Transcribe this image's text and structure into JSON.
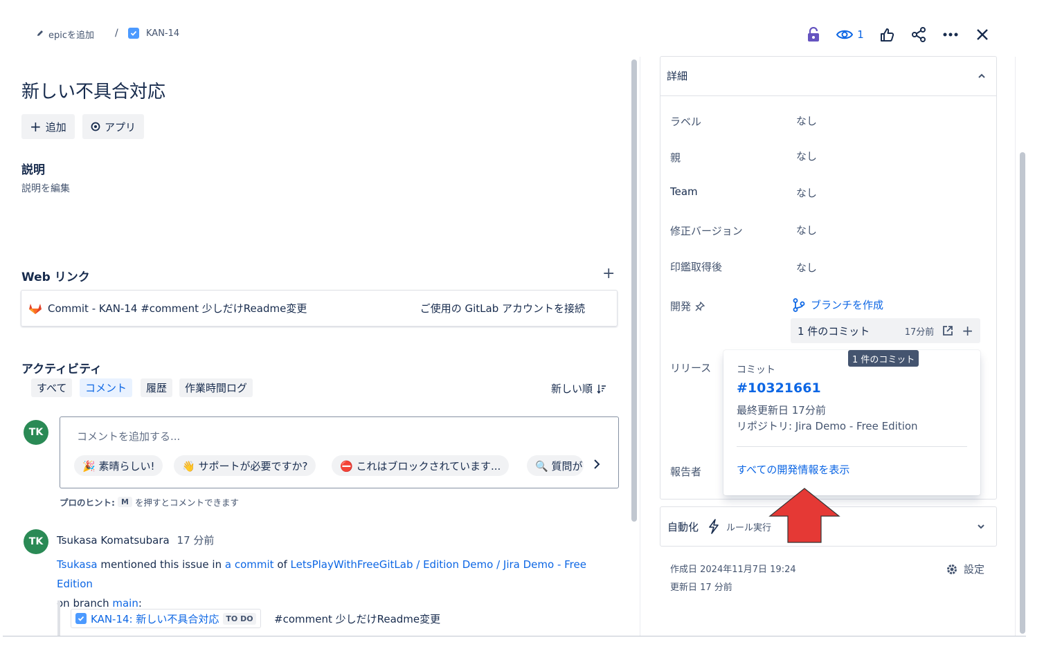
{
  "breadcrumb": {
    "epic_label": "epicを追加",
    "separator": "/",
    "issue_key": "KAN-14"
  },
  "top_actions": {
    "watch_count": "1"
  },
  "issue": {
    "title": "新しい不具合対応"
  },
  "toolbar": {
    "add_label": "追加",
    "apps_label": "アプリ"
  },
  "description": {
    "heading": "説明",
    "edit_label": "説明を編集"
  },
  "weblinks": {
    "heading": "Web リンク",
    "item_text": "Commit - KAN-14 #comment 少しだけReadme変更",
    "connect_label": "ご使用の GitLab アカウントを接続"
  },
  "activity": {
    "heading": "アクティビティ",
    "tabs": [
      "すべて",
      "コメント",
      "履歴",
      "作業時間ログ"
    ],
    "sort_label": "新しい順"
  },
  "comment_box": {
    "avatar_initials": "TK",
    "placeholder": "コメントを追加する...",
    "chips": [
      "🎉 素晴らしい!",
      "👋 サポートが必要ですか?",
      "⛔ これはブロックされています...",
      "🔍 質問が"
    ]
  },
  "hint": {
    "prefix": "プロのヒント:",
    "key": "M",
    "suffix": "を押すとコメントできます"
  },
  "comment": {
    "avatar_initials": "TK",
    "author": "Tsukasa Komatsubara",
    "time": "17 分前",
    "mention_user": "Tsukasa",
    "text_1": " mentioned this issue in ",
    "commit_link": "a commit",
    "text_2": " of ",
    "repo_link": "LetsPlayWithFreeGitLab / Edition Demo / Jira Demo - Free Edition",
    "text_3": "on branch ",
    "branch": "main",
    "text_4": ":",
    "issue_link": "KAN-14: 新しい不具合対応",
    "status": "TO DO",
    "message": "#comment 少しだけReadme変更"
  },
  "details": {
    "heading": "詳細",
    "fields": [
      {
        "label": "ラベル",
        "value": "なし"
      },
      {
        "label": "親",
        "value": "なし"
      },
      {
        "label": "Team",
        "value": "なし"
      },
      {
        "label": "修正バージョン",
        "value": "なし"
      },
      {
        "label": "印鑑取得後",
        "value": "なし"
      }
    ],
    "development_label": "開発",
    "create_branch": "ブランチを作成",
    "commits_label": "1 件のコミット",
    "commits_time": "17分前",
    "release_label": "リリース",
    "reporter_label": "報告者"
  },
  "tooltip": {
    "text": "1 件のコミット"
  },
  "popup": {
    "heading": "コミット",
    "commit_id": "#10321661",
    "updated": "最終更新日 17分前",
    "repository": "リポジトリ: Jira Demo - Free Edition",
    "view_all": "すべての開発情報を表示"
  },
  "automation": {
    "heading": "自動化",
    "rule_label": "ルール実行"
  },
  "meta": {
    "created": "作成日 2024年11月7日 19:24",
    "updated": "更新日 17 分前",
    "settings_label": "設定"
  },
  "colors": {
    "accent": "#0c66e4",
    "avatar": "#2a8a55",
    "arrow": "#e53935"
  }
}
